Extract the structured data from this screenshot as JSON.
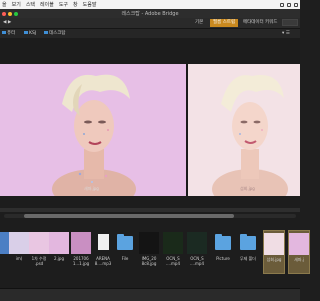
{
  "menubar": {
    "items": [
      "을",
      "보기",
      "스택",
      "레이블",
      "도구",
      "창",
      "도움말"
    ]
  },
  "window": {
    "title": "레스크탑 - Adobe Bridge"
  },
  "toolbar": {
    "workspaces": [
      "기본",
      "필름 스트립",
      "메타데이터",
      "키워드"
    ],
    "active_workspace": "필름 스트립"
  },
  "breadcrumb": {
    "items": [
      "퓨터",
      "KSJ",
      "데스크탑"
    ]
  },
  "preview": {
    "left_caption": "새파.jpg",
    "right_caption": "섬회.jpg"
  },
  "filmstrip": {
    "thumbnails": [
      {
        "label": "",
        "kind": "partial"
      },
      {
        "label": "im)",
        "kind": "image"
      },
      {
        "label": "1차 수정\n.psd",
        "kind": "image"
      },
      {
        "label": "2.jpg",
        "kind": "image"
      },
      {
        "label": "201706\n1...1.jpg",
        "kind": "image"
      },
      {
        "label": "ARENA\n8....mp3",
        "kind": "doc"
      },
      {
        "label": "File",
        "kind": "folder"
      },
      {
        "label": "IMG_20\n8c8.jpg",
        "kind": "image"
      },
      {
        "label": "OCN_S\n....mp4",
        "kind": "image"
      },
      {
        "label": "OCN_S\n....mp4",
        "kind": "image"
      },
      {
        "label": "Picture",
        "kind": "folder"
      },
      {
        "label": "무제 폴더",
        "kind": "folder"
      },
      {
        "label": "섬회.jpg",
        "kind": "image",
        "selected": true
      },
      {
        "label": "새파.j",
        "kind": "image",
        "selected": true
      }
    ]
  },
  "colors": {
    "accent": "#c9891f",
    "folder": "#5ba3e0",
    "left_background": "#e7bfe6",
    "right_background": "#f3e2e6"
  }
}
